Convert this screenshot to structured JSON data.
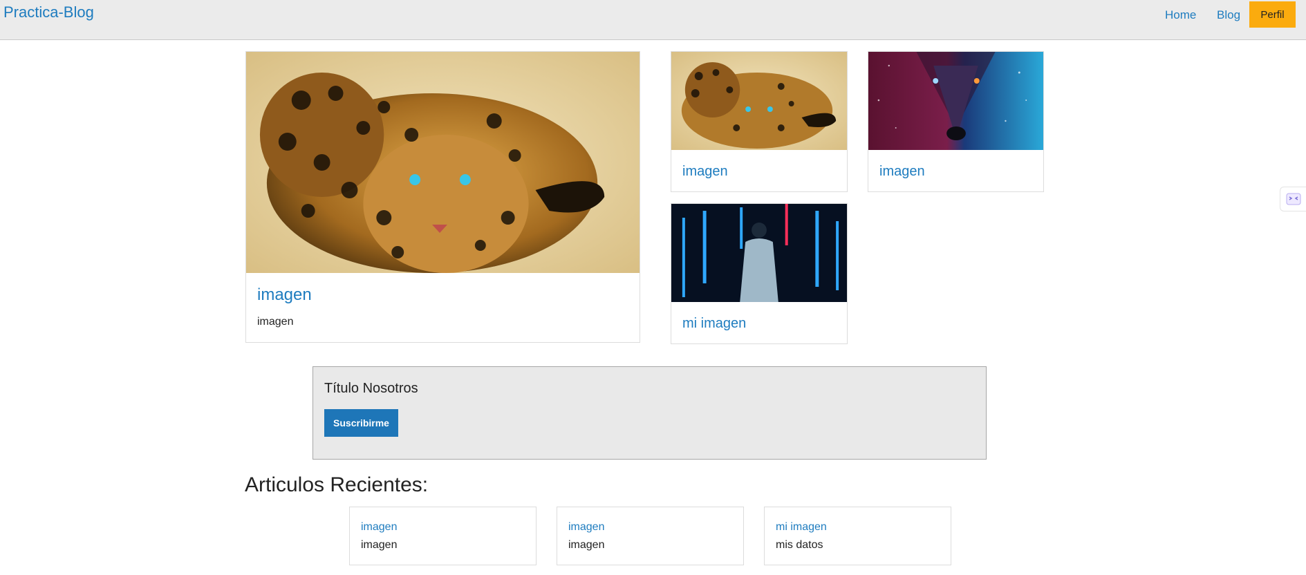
{
  "header": {
    "brand": "Practica-Blog",
    "nav": {
      "home": "Home",
      "blog": "Blog",
      "perfil": "Perfil"
    }
  },
  "featured": {
    "main": {
      "title": "imagen",
      "text": "imagen",
      "image": "leopard-image"
    },
    "small": [
      {
        "title": "imagen",
        "image": "leopard-image"
      },
      {
        "title": "imagen",
        "image": "wolf-image"
      },
      {
        "title": "mi imagen",
        "image": "neon-person-image"
      }
    ]
  },
  "nosotros": {
    "title": "Título Nosotros",
    "button": "Suscribirme"
  },
  "recent": {
    "heading": "Articulos Recientes:",
    "items": [
      {
        "title": "imagen",
        "text": "imagen"
      },
      {
        "title": "imagen",
        "text": "imagen"
      },
      {
        "title": "mi imagen",
        "text": "mis datos"
      }
    ]
  },
  "side_tab": {
    "icon": "extension-icon"
  },
  "colors": {
    "link": "#1e7cbf",
    "header_bg": "#ebebeb",
    "perfil_bg": "#fbab0e",
    "button_bg": "#1e76b8",
    "panel_bg": "#e9e9e9"
  }
}
